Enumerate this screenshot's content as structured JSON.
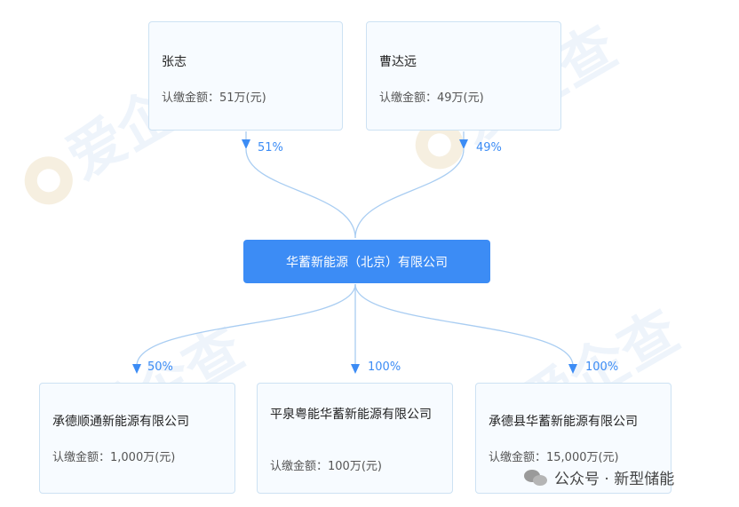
{
  "shareholders": [
    {
      "name": "张志",
      "amount": "认缴金额：51万(元)",
      "percent": "51%"
    },
    {
      "name": "曹达远",
      "amount": "认缴金额：49万(元)",
      "percent": "49%"
    }
  ],
  "company": {
    "name": "华蓄新能源（北京）有限公司"
  },
  "subsidiaries": [
    {
      "name": "承德顺通新能源有限公司",
      "amount": "认缴金额：1,000万(元)",
      "percent": "50%"
    },
    {
      "name": "平泉粤能华蓄新能源有限公司",
      "amount": "认缴金额：100万(元)",
      "percent": "100%"
    },
    {
      "name": "承德县华蓄新能源有限公司",
      "amount": "认缴金额：15,000万(元)",
      "percent": "100%"
    }
  ],
  "watermark": {
    "text": "爱企查"
  },
  "footer": {
    "text": "公众号 · 新型储能"
  },
  "colors": {
    "accent": "#3c8cf5",
    "connector": "#a9cdf2",
    "card_bg": "#f7fbff",
    "card_border": "#cde2f3"
  }
}
